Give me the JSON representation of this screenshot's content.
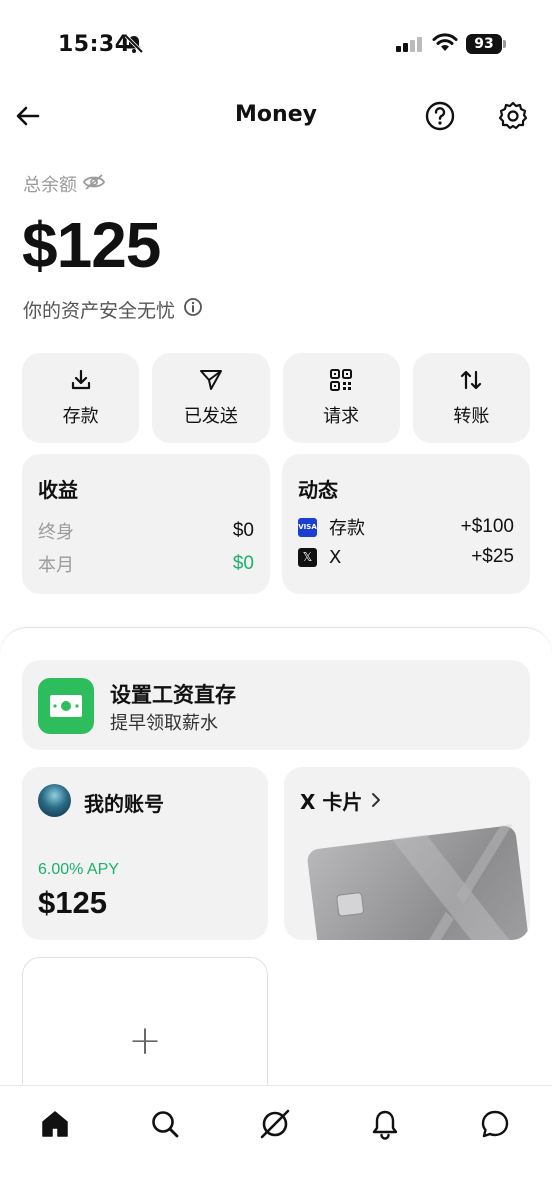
{
  "status_bar": {
    "time": "15:34",
    "battery": "93",
    "icons": [
      "bell-muted-icon",
      "signal-icon",
      "wifi-icon",
      "battery-icon"
    ]
  },
  "header": {
    "title": "Money",
    "back_icon": "arrow-left-icon",
    "help_icon": "question-circle-icon",
    "settings_icon": "gear-icon"
  },
  "balance": {
    "label": "总余额",
    "amount": "$125",
    "safety_note": "你的资产安全无忧",
    "visibility_icon": "eye-off-icon",
    "info_icon": "info-icon"
  },
  "actions": [
    {
      "label": "存款",
      "icon": "download-icon"
    },
    {
      "label": "已发送",
      "icon": "send-icon"
    },
    {
      "label": "请求",
      "icon": "qr-code-icon"
    },
    {
      "label": "转账",
      "icon": "transfer-arrows-icon"
    }
  ],
  "earnings": {
    "title": "收益",
    "rows": [
      {
        "label": "终身",
        "value": "$0"
      },
      {
        "label": "本月",
        "value": "$0"
      }
    ]
  },
  "activity": {
    "title": "动态",
    "rows": [
      {
        "label": "存款",
        "value": "+$100",
        "icon_text": "VISA"
      },
      {
        "label": "X",
        "value": "+$25",
        "icon_text": "𝕏"
      }
    ]
  },
  "promo": {
    "title": "设置工资直存",
    "subtitle": "提早领取薪水"
  },
  "account": {
    "title": "我的账号",
    "apy": "6.00% APY",
    "balance": "$125"
  },
  "x_card": {
    "title": "X 卡片"
  },
  "add_card": {
    "symbol": "+"
  },
  "tabbar": {
    "items": [
      "home-icon",
      "search-icon",
      "grok-icon",
      "notifications-icon",
      "messages-icon"
    ]
  },
  "colors": {
    "accent_green": "#1db16b",
    "promo_green": "#2ebd5c",
    "card_bg": "#f2f2f3"
  }
}
